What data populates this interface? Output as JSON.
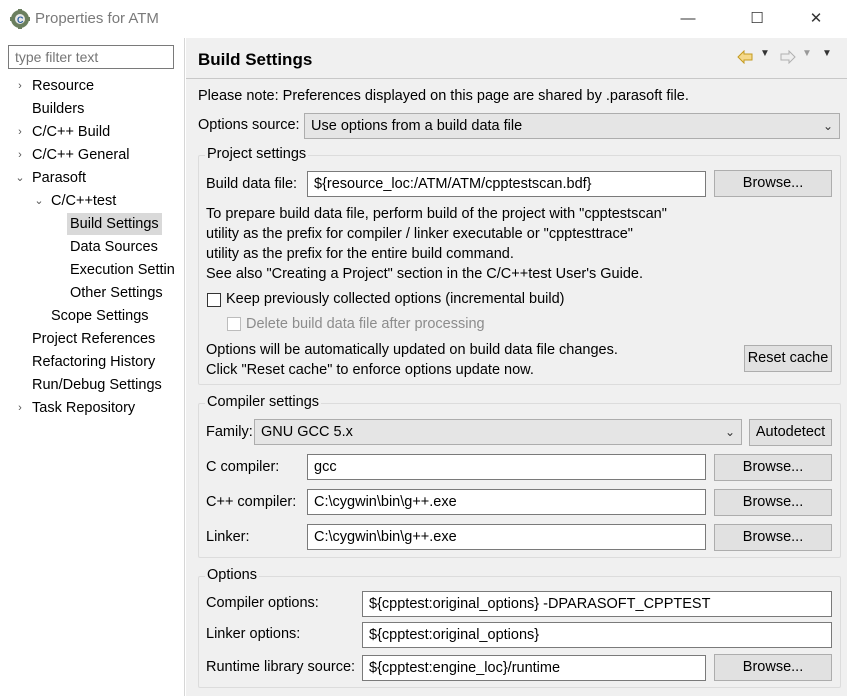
{
  "window": {
    "title": "Properties for ATM",
    "minimize": "—",
    "maximize": "☐",
    "close": "✕"
  },
  "sidebar": {
    "filter_placeholder": "type filter text",
    "items": [
      {
        "label": "Resource",
        "expandable": true,
        "expanded": false
      },
      {
        "label": "Builders",
        "expandable": false
      },
      {
        "label": "C/C++ Build",
        "expandable": true,
        "expanded": false
      },
      {
        "label": "C/C++ General",
        "expandable": true,
        "expanded": false
      },
      {
        "label": "Parasoft",
        "expandable": true,
        "expanded": true
      },
      {
        "label": "C/C++test",
        "expandable": true,
        "expanded": true
      },
      {
        "label": "Build Settings",
        "selected": true
      },
      {
        "label": "Data Sources"
      },
      {
        "label": "Execution Settin"
      },
      {
        "label": "Other Settings"
      },
      {
        "label": "Scope Settings"
      },
      {
        "label": "Project References"
      },
      {
        "label": "Refactoring History"
      },
      {
        "label": "Run/Debug Settings"
      },
      {
        "label": "Task Repository",
        "expandable": true,
        "expanded": false
      }
    ]
  },
  "main": {
    "heading": "Build Settings",
    "note": "Please note: Preferences displayed on this page are shared by .parasoft file.",
    "options_source_label": "Options source:",
    "options_source_value": "Use options from a build data file",
    "project": {
      "title": "Project settings",
      "bdf_label": "Build data file:",
      "bdf_value": "${resource_loc:/ATM/ATM/cpptestscan.bdf}",
      "browse": "Browse...",
      "info": [
        "To prepare build data file, perform build of the project with \"cpptestscan\"",
        "utility as the prefix for compiler / linker executable or \"cpptesttrace\"",
        "utility as the prefix for the entire build command.",
        "See also \"Creating a Project\" section in the C/C++test User's Guide."
      ],
      "keep_label": "Keep previously collected options (incremental build)",
      "delete_label": "Delete build data file after processing",
      "auto_info": [
        "Options will be automatically updated on build data file changes.",
        "Click \"Reset cache\" to enforce options update now."
      ],
      "reset_cache": "Reset cache"
    },
    "compiler": {
      "title": "Compiler settings",
      "family_label": "Family:",
      "family_value": "GNU GCC 5.x",
      "autodetect": "Autodetect",
      "c_label": "C compiler:",
      "c_value": "gcc",
      "cpp_label": "C++ compiler:",
      "cpp_value": "C:\\cygwin\\bin\\g++.exe",
      "linker_label": "Linker:",
      "linker_value": "C:\\cygwin\\bin\\g++.exe",
      "browse": "Browse..."
    },
    "options": {
      "title": "Options",
      "compiler_options_label": "Compiler options:",
      "compiler_options_value": "${cpptest:original_options} -DPARASOFT_CPPTEST",
      "linker_options_label": "Linker options:",
      "linker_options_value": "${cpptest:original_options}",
      "runtime_label": "Runtime library source:",
      "runtime_value": "${cpptest:engine_loc}/runtime",
      "browse": "Browse..."
    }
  }
}
